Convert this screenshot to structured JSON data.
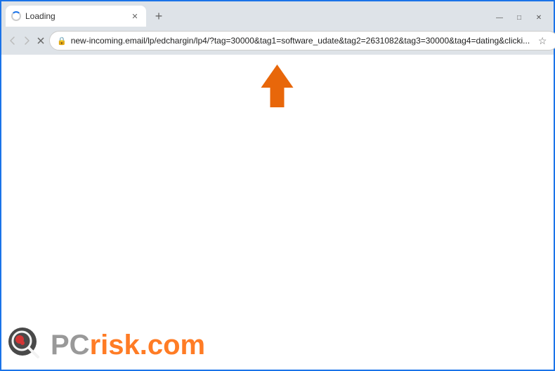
{
  "browser": {
    "tab": {
      "title": "Loading",
      "spinner": true
    },
    "new_tab_label": "+",
    "window_controls": {
      "minimize": "—",
      "maximize": "□",
      "close": "✕"
    },
    "address_bar": {
      "url": "new-incoming.email/lp/edchargin/lp4/?tag=30000&tag1=software_udate&tag2=2631082&tag3=30000&tag4=dating&clicki...",
      "lock_icon": "🔒"
    },
    "nav": {
      "back": "←",
      "forward": "→",
      "reload": "✕"
    }
  },
  "watermark": {
    "pc_text": "PC",
    "risk_text": "risk.com"
  },
  "arrow": {
    "label": "annotation-arrow"
  }
}
